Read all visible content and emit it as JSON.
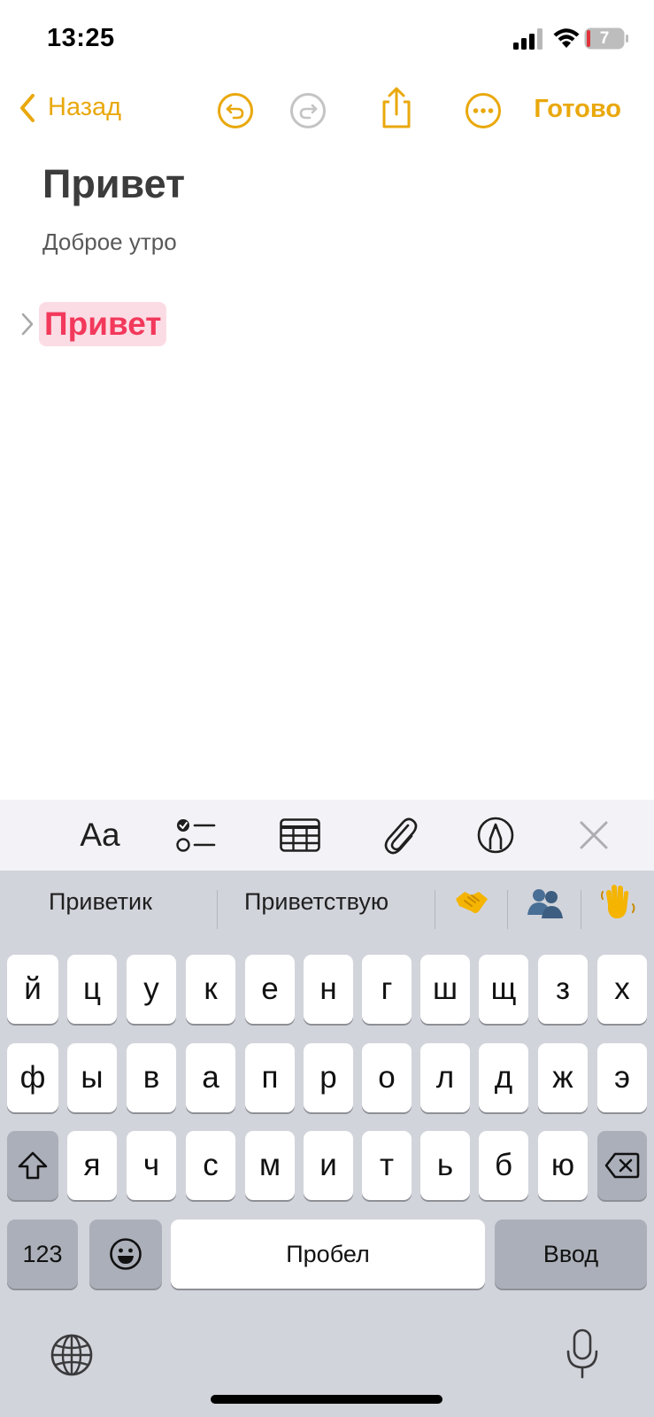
{
  "status_bar": {
    "time": "13:25",
    "battery": "7"
  },
  "nav": {
    "back_label": "Назад",
    "done_label": "Готово"
  },
  "note": {
    "title": "Привет",
    "subtitle": "Доброе утро",
    "collapsed_heading": "Привет"
  },
  "format_bar": {
    "text_style_label": "Aa"
  },
  "keyboard": {
    "suggestions": [
      "Приветик",
      "Приветствую"
    ],
    "emoji_suggestions": [
      "🤝",
      "👥",
      "👋"
    ],
    "row1": [
      "й",
      "ц",
      "у",
      "к",
      "е",
      "н",
      "г",
      "ш",
      "щ",
      "з",
      "х"
    ],
    "row2": [
      "ф",
      "ы",
      "в",
      "а",
      "п",
      "р",
      "о",
      "л",
      "д",
      "ж",
      "э"
    ],
    "row3": [
      "я",
      "ч",
      "с",
      "м",
      "и",
      "т",
      "ь",
      "б",
      "ю"
    ],
    "numbers_label": "123",
    "space_label": "Пробел",
    "return_label": "Ввод"
  },
  "colors": {
    "accent": "#e9a80c",
    "heading_highlight": "#fcdce4",
    "heading_text": "#f2395b"
  }
}
